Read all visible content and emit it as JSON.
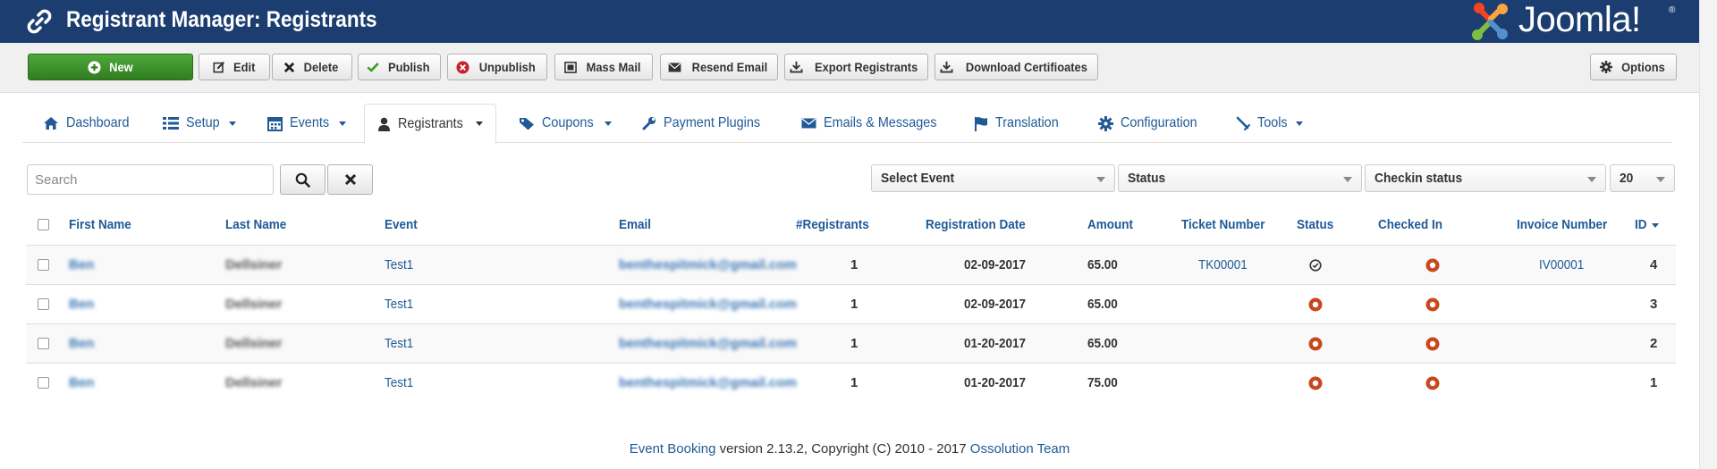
{
  "header": {
    "title": "Registrant Manager: Registrants",
    "brand": "Joomla!",
    "brand_reg": "®"
  },
  "toolbar": {
    "new_label": "New",
    "edit_label": "Edit",
    "delete_label": "Delete",
    "publish_label": "Publish",
    "unpublish_label": "Unpublish",
    "mass_mail_label": "Mass Mail",
    "resend_email_label": "Resend Email",
    "export_label": "Export Registrants",
    "certificates_label": "Download Certifioates",
    "options_label": "Options"
  },
  "nav": {
    "dashboard": "Dashboard",
    "setup": "Setup",
    "events": "Events",
    "registrants": "Registrants",
    "coupons": "Coupons",
    "payment_plugins": "Payment Plugins",
    "emails": "Emails & Messages",
    "translation": "Translation",
    "configuration": "Configuration",
    "tools": "Tools"
  },
  "filters": {
    "search_placeholder": "Search",
    "select_event": "Select Event",
    "status": "Status",
    "checkin_status": "Checkin status",
    "limit": "20"
  },
  "table": {
    "columns": {
      "first_name": "First Name",
      "last_name": "Last Name",
      "event": "Event",
      "email": "Email",
      "registrants": "#Registrants",
      "registration_date": "Registration Date",
      "amount": "Amount",
      "ticket_number": "Ticket Number",
      "status": "Status",
      "checked_in": "Checked In",
      "invoice_number": "Invoice Number",
      "id": "ID"
    },
    "rows": [
      {
        "first_name": "Ben",
        "last_name": "Dellsiner",
        "event": "Test1",
        "email": "benthespitmick@gmail.com",
        "registrants": "1",
        "date": "02-09-2017",
        "amount": "65.00",
        "ticket": "TK00001",
        "status": "published",
        "checked_in": "no",
        "invoice": "IV00001",
        "id": "4"
      },
      {
        "first_name": "Ben",
        "last_name": "Dellsiner",
        "event": "Test1",
        "email": "benthespitmick@gmail.com",
        "registrants": "1",
        "date": "02-09-2017",
        "amount": "65.00",
        "ticket": "",
        "status": "unpublished",
        "checked_in": "no",
        "invoice": "",
        "id": "3"
      },
      {
        "first_name": "Ben",
        "last_name": "Dellsiner",
        "event": "Test1",
        "email": "benthespitmick@gmail.com",
        "registrants": "1",
        "date": "01-20-2017",
        "amount": "65.00",
        "ticket": "",
        "status": "unpublished",
        "checked_in": "no",
        "invoice": "",
        "id": "2"
      },
      {
        "first_name": "Ben",
        "last_name": "Dellsiner",
        "event": "Test1",
        "email": "benthespitmick@gmail.com",
        "registrants": "1",
        "date": "01-20-2017",
        "amount": "75.00",
        "ticket": "",
        "status": "unpublished",
        "checked_in": "no",
        "invoice": "",
        "id": "1"
      }
    ]
  },
  "footer": {
    "product_link": "Event Booking",
    "text": " version 2.13.2, Copyright (C) 2010 - 2017 ",
    "team_link": "Ossolution Team"
  },
  "colors": {
    "header_bg": "#1c3d70",
    "link": "#1f5a96",
    "new_button": "#3b9b2a",
    "status_red": "#c8471c"
  },
  "icons": {
    "header": "link-icon",
    "status_published": "check-circle-icon",
    "status_unpublished": "red-circle-icon"
  }
}
